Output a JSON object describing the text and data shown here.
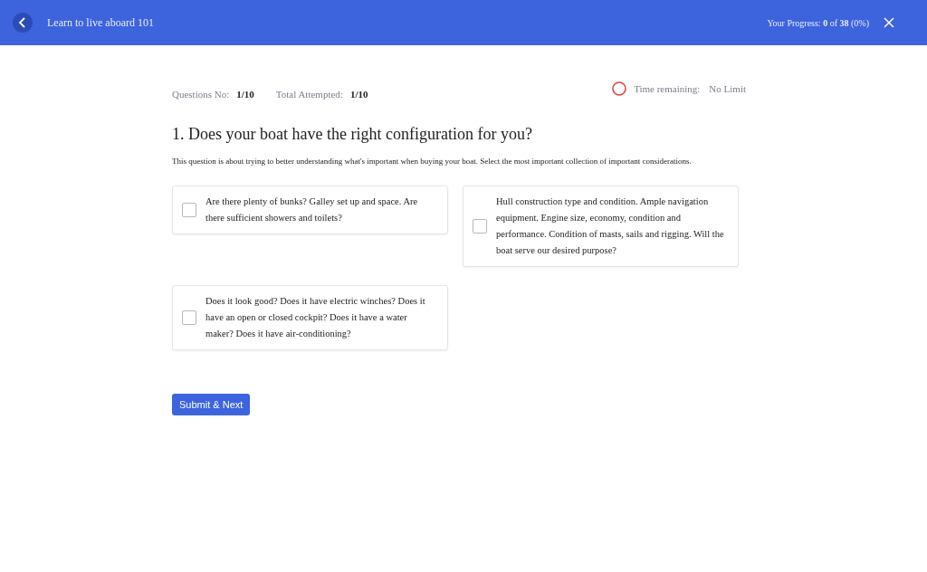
{
  "header": {
    "title": "Learn to live aboard 101",
    "progress": "Your Progress: **0** of **38** (0%)"
  },
  "stats": [
    {
      "label": "Questions No:",
      "value": "1/10"
    },
    {
      "label": "Total Attempted:",
      "value": "1/10"
    }
  ],
  "timer": {
    "label": "Time remaining:",
    "value": "No Limit"
  },
  "question": {
    "title": "1. Does your boat have the right configuration for you?",
    "description": "This question is about trying to better understanding what's important when buying your boat. Select the most important collection of important considerations."
  },
  "options": [
    {
      "text": "Are there plenty of bunks? Galley set up and space. Are there sufficient showers and toilets?",
      "checked": false
    },
    {
      "text": "Hull construction type and condition. Ample navigation equipment. Engine size, economy, condition and performance. Condition of masts, sails and rigging. Will the boat serve our desired purpose?",
      "checked": false
    },
    {
      "text": "Does it look good? Does it have electric winches? Does it have an open or closed cockpit? Does it have a water maker? Does it have air-conditioning?",
      "checked": false
    }
  ],
  "submit_button": "Submit & Next"
}
